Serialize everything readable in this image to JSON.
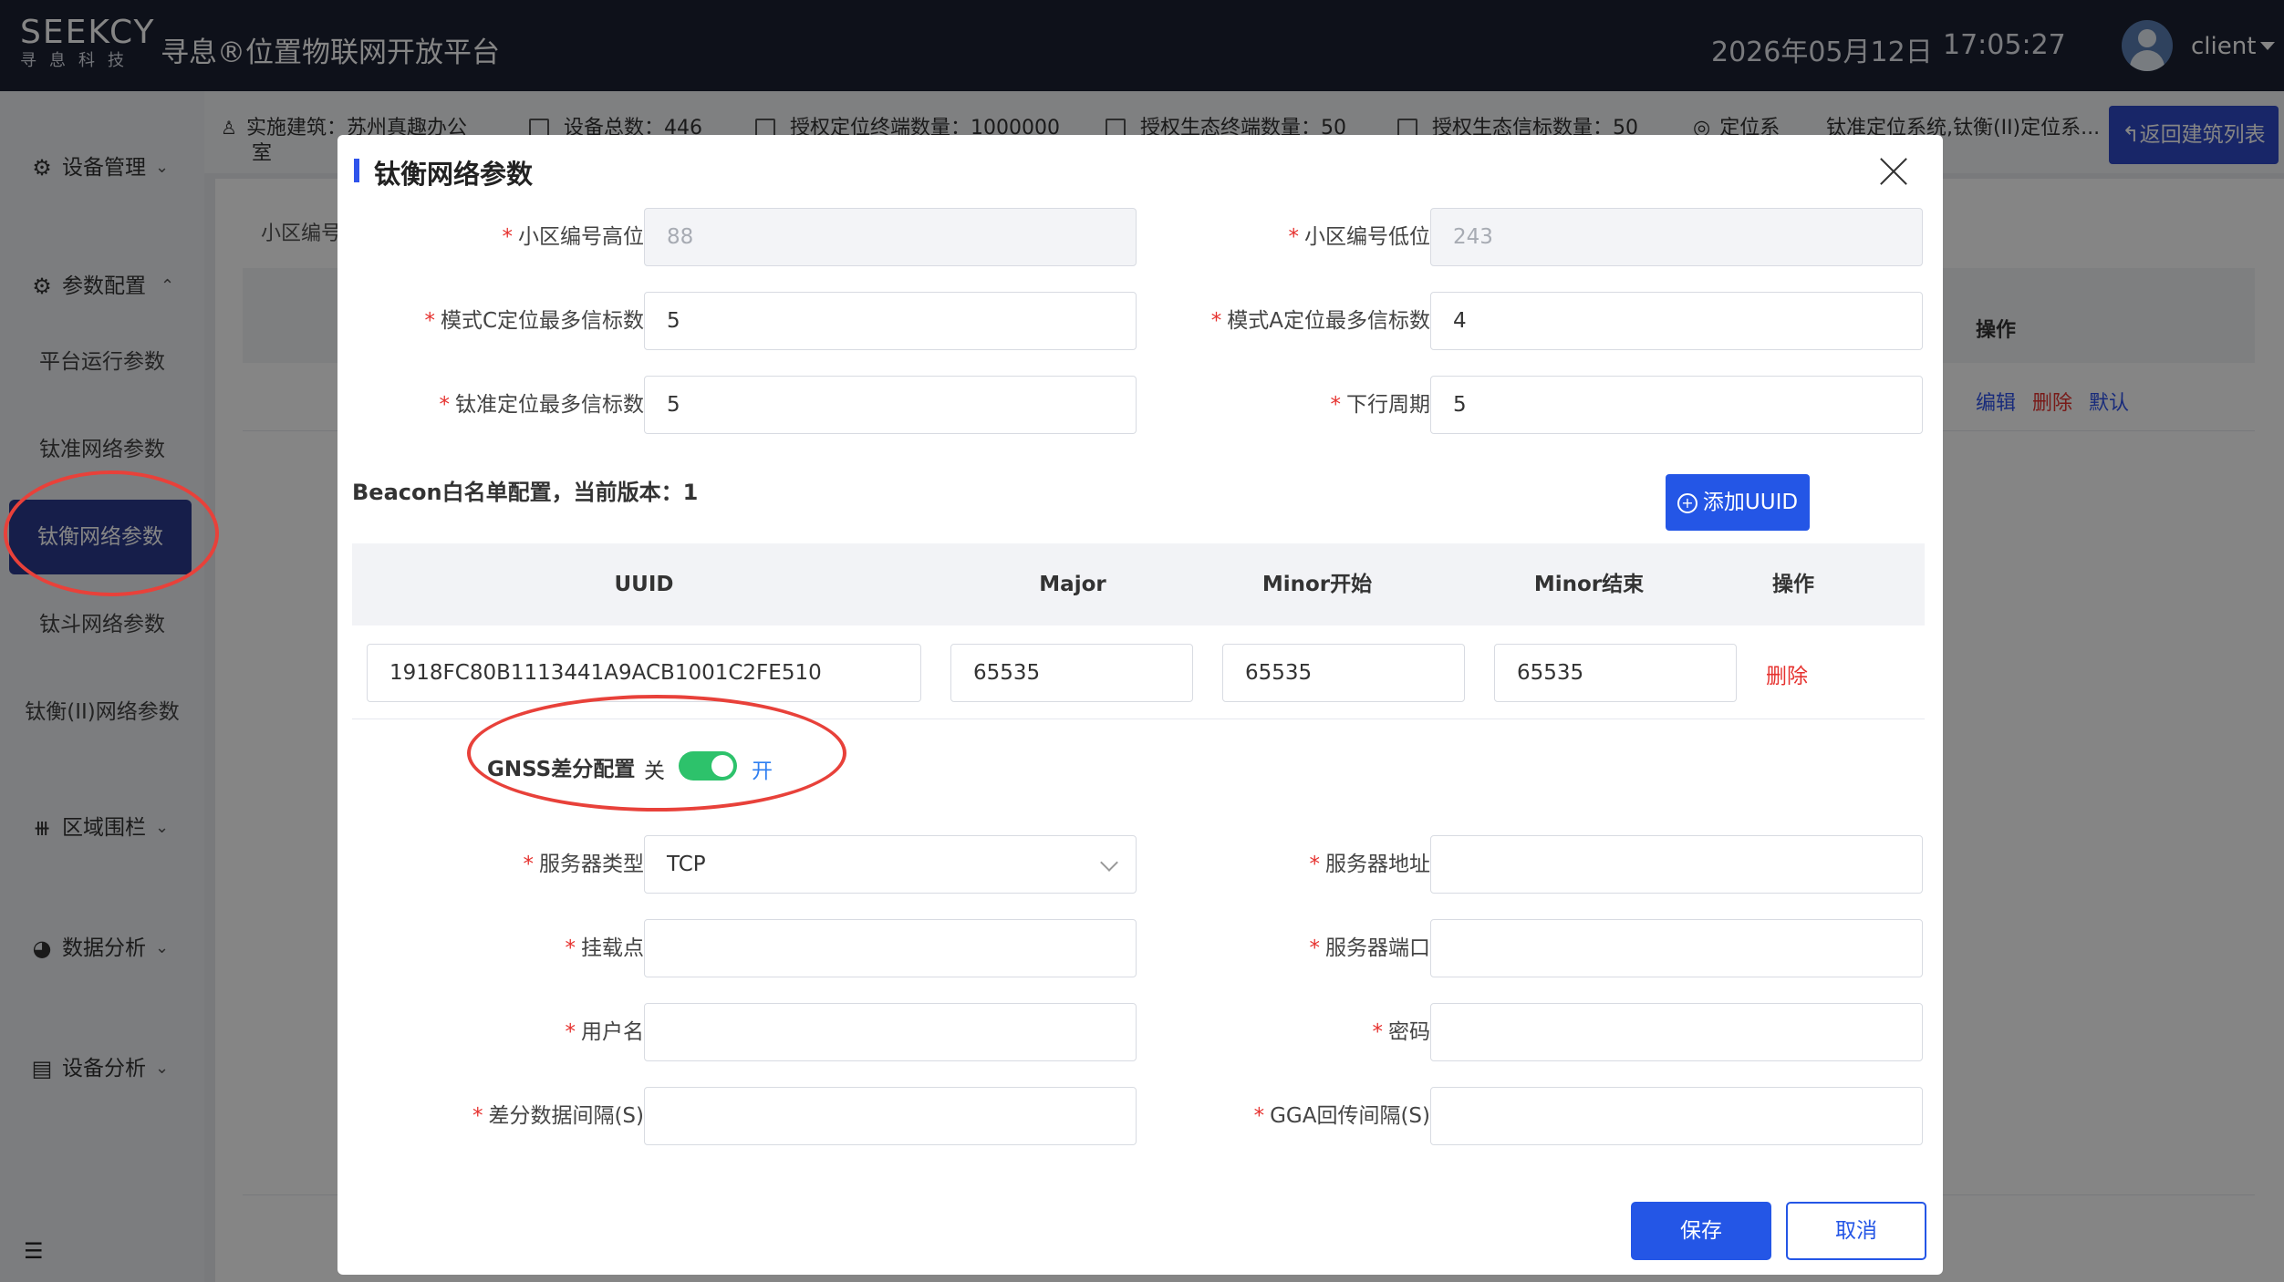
{
  "header": {
    "logo_main": "SEEKCY",
    "logo_sub": "寻息科技",
    "title": "寻息®位置物联网开放平台",
    "date": "2026年05月12日",
    "time": "17:05:27",
    "username": "client"
  },
  "sidebar": {
    "device_mgmt": "设备管理",
    "param_config": "参数配置",
    "sub_items": [
      "平台运行参数",
      "钛准网络参数",
      "钛衡网络参数",
      "钛斗网络参数",
      "钛衡(II)网络参数"
    ],
    "geofence": "区域围栏",
    "data_analysis": "数据分析",
    "device_analysis": "设备分析",
    "active_item": "钛衡网络参数"
  },
  "stats": {
    "building": "实施建筑：苏州真趣办公",
    "building_cont": "室",
    "device_total": "设备总数：446",
    "auth_terminals": "授权定位终端数量：1000000",
    "eco_terminals": "授权生态终端数量：50",
    "eco_beacons": "授权生态信标数量：50",
    "positioning": "定位系",
    "positioning_systems": "钛准定位系统,钛衡(II)定位系..."
  },
  "back_button": "返回建筑列表",
  "content": {
    "cell_label": "小区编号",
    "operation_header": "操作",
    "row_actions": [
      "编辑",
      "删除",
      "默认"
    ]
  },
  "modal": {
    "title": "钛衡网络参数",
    "fields": {
      "cell_high_label": "小区编号高位",
      "cell_high_value": "88",
      "cell_low_label": "小区编号低位",
      "cell_low_value": "243",
      "mode_c_label": "模式C定位最多信标数",
      "mode_c_value": "5",
      "mode_a_label": "模式A定位最多信标数",
      "mode_a_value": "4",
      "tizhun_label": "钛准定位最多信标数",
      "tizhun_value": "5",
      "downlink_label": "下行周期",
      "downlink_value": "5"
    },
    "beacon_title": "Beacon白名单配置，当前版本：1",
    "add_uuid": "添加UUID",
    "beacon_table": {
      "headers": [
        "UUID",
        "Major",
        "Minor开始",
        "Minor结束",
        "操作"
      ],
      "rows": [
        {
          "uuid": "1918FC80B1113441A9ACB1001C2FE510",
          "major": "65535",
          "minor_start": "65535",
          "minor_end": "65535",
          "action": "删除"
        }
      ]
    },
    "gnss": {
      "label": "GNSS差分配置",
      "off_text": "关",
      "on_text": "开",
      "enabled": true
    },
    "gnss_fields": {
      "server_type_label": "服务器类型",
      "server_type_value": "TCP",
      "server_addr_label": "服务器地址",
      "mount_label": "挂载点",
      "server_port_label": "服务器端口",
      "username_label": "用户名",
      "password_label": "密码",
      "diff_interval_label": "差分数据间隔(S)",
      "gga_interval_label": "GGA回传间隔(S)"
    },
    "save": "保存",
    "cancel": "取消"
  },
  "colors": {
    "primary": "#2456e6",
    "topbar": "#1c2133",
    "danger": "#e6322f",
    "switch_on": "#2dc26b",
    "annotation": "#e8413a"
  }
}
